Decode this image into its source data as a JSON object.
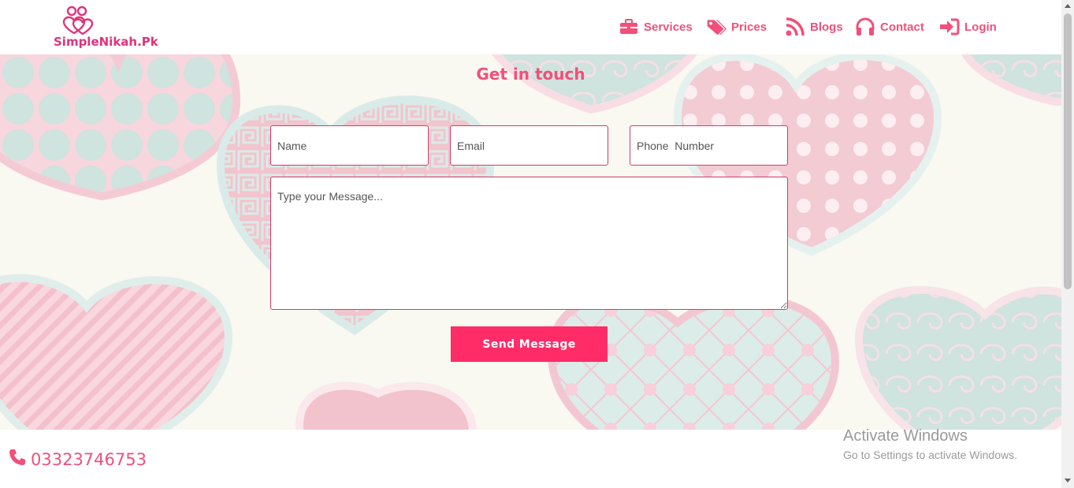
{
  "brand": {
    "name": "SimpleNikah.Pk",
    "color": "#e0337b"
  },
  "nav": {
    "items": [
      {
        "label": "Services",
        "icon": "briefcase-icon"
      },
      {
        "label": "Prices",
        "icon": "tags-icon"
      },
      {
        "label": "Blogs",
        "icon": "rss-icon"
      },
      {
        "label": "Contact",
        "icon": "headphones-icon"
      },
      {
        "label": "Login",
        "icon": "sign-in-icon"
      }
    ]
  },
  "contact_form": {
    "title": "Get in touch",
    "name_placeholder": "Name",
    "email_placeholder": "Email",
    "phone_placeholder": "Phone  Number",
    "message_placeholder": "Type your Message...",
    "submit_label": "Send Message"
  },
  "footer": {
    "phone": "03323746753",
    "phone_icon": "phone-icon"
  },
  "watermark": {
    "line1": "Activate Windows",
    "line2": "Go to Settings to activate Windows."
  },
  "colors": {
    "accent": "#f0507a",
    "button": "#ff2c68",
    "hero_bg": "#f9f8f1"
  }
}
